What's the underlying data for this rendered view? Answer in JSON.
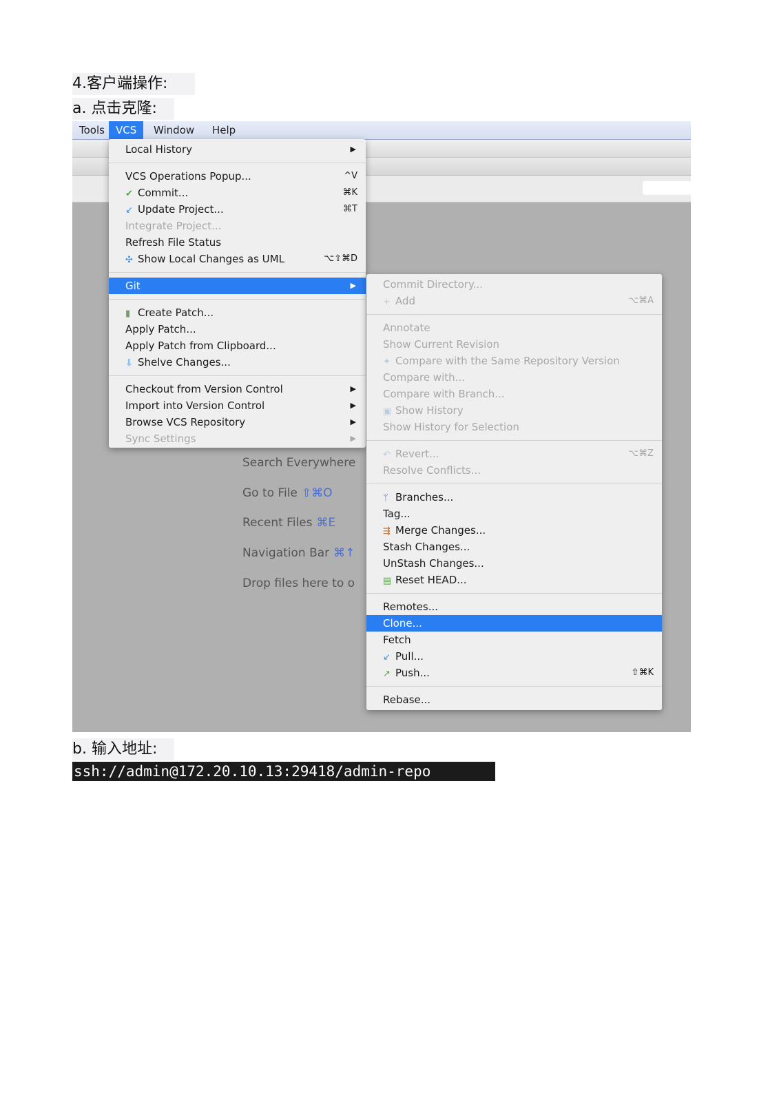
{
  "headings": {
    "section": "4.客户端操作:",
    "step_a": "a. 点击克隆:",
    "step_b": "b. 输入地址:"
  },
  "code": "ssh://admin@172.20.10.13:29418/admin-repo",
  "colors": {
    "selection": "#2b7ef2",
    "background": "#b0b0b0",
    "menu": "#efefef"
  },
  "menubar": [
    {
      "label": "Tools"
    },
    {
      "label": "VCS",
      "active": true
    },
    {
      "label": "Window"
    },
    {
      "label": "Help"
    }
  ],
  "hints": [
    {
      "text": "Search Everywhere",
      "key": ""
    },
    {
      "text": "Go to File",
      "key": "⇧⌘O"
    },
    {
      "text": "Recent Files",
      "key": "⌘E"
    },
    {
      "text": "Navigation Bar",
      "key": "⌘↑"
    },
    {
      "text": "Drop files here to o",
      "key": ""
    }
  ],
  "vcs_menu": [
    {
      "label": "Local History",
      "submenu": true
    },
    {
      "sep": true
    },
    {
      "label": "VCS Operations Popup...",
      "shortcut": "^V"
    },
    {
      "label": "Commit...",
      "shortcut": "⌘K",
      "icon": "commit-icon"
    },
    {
      "label": "Update Project...",
      "shortcut": "⌘T",
      "icon": "update-icon"
    },
    {
      "label": "Integrate Project...",
      "disabled": true
    },
    {
      "label": "Refresh File Status"
    },
    {
      "label": "Show Local Changes as UML",
      "shortcut": "⌥⇧⌘D",
      "icon": "uml-icon"
    },
    {
      "sep": true
    },
    {
      "label": "Git",
      "submenu": true,
      "selected": true
    },
    {
      "sep": true
    },
    {
      "label": "Create Patch...",
      "icon": "patch-icon"
    },
    {
      "label": "Apply Patch..."
    },
    {
      "label": "Apply Patch from Clipboard..."
    },
    {
      "label": "Shelve Changes...",
      "icon": "shelve-icon"
    },
    {
      "sep": true
    },
    {
      "label": "Checkout from Version Control",
      "submenu": true
    },
    {
      "label": "Import into Version Control",
      "submenu": true
    },
    {
      "label": "Browse VCS Repository",
      "submenu": true
    },
    {
      "label": "Sync Settings",
      "submenu": true,
      "disabled": true
    }
  ],
  "git_menu": [
    {
      "label": "Commit Directory...",
      "disabled": true
    },
    {
      "label": "Add",
      "shortcut": "⌥⌘A",
      "disabled": true,
      "icon": "add-icon"
    },
    {
      "sep": true
    },
    {
      "label": "Annotate",
      "disabled": true
    },
    {
      "label": "Show Current Revision",
      "disabled": true
    },
    {
      "label": "Compare with the Same Repository Version",
      "disabled": true,
      "icon": "compare-icon"
    },
    {
      "label": "Compare with...",
      "disabled": true
    },
    {
      "label": "Compare with Branch...",
      "disabled": true
    },
    {
      "label": "Show History",
      "disabled": true,
      "icon": "history-icon"
    },
    {
      "label": "Show History for Selection",
      "disabled": true
    },
    {
      "sep": true
    },
    {
      "label": "Revert...",
      "shortcut": "⌥⌘Z",
      "disabled": true,
      "icon": "revert-icon"
    },
    {
      "label": "Resolve Conflicts...",
      "disabled": true
    },
    {
      "sep": true
    },
    {
      "label": "Branches...",
      "icon": "branch-icon"
    },
    {
      "label": "Tag..."
    },
    {
      "label": "Merge Changes...",
      "icon": "merge-icon"
    },
    {
      "label": "Stash Changes..."
    },
    {
      "label": "UnStash Changes..."
    },
    {
      "label": "Reset HEAD...",
      "icon": "reset-icon"
    },
    {
      "sep": true
    },
    {
      "label": "Remotes..."
    },
    {
      "label": "Clone...",
      "selected": true
    },
    {
      "label": "Fetch"
    },
    {
      "label": "Pull...",
      "icon": "pull-icon"
    },
    {
      "label": "Push...",
      "shortcut": "⇧⌘K",
      "icon": "push-icon"
    },
    {
      "sep": true
    },
    {
      "label": "Rebase..."
    }
  ]
}
